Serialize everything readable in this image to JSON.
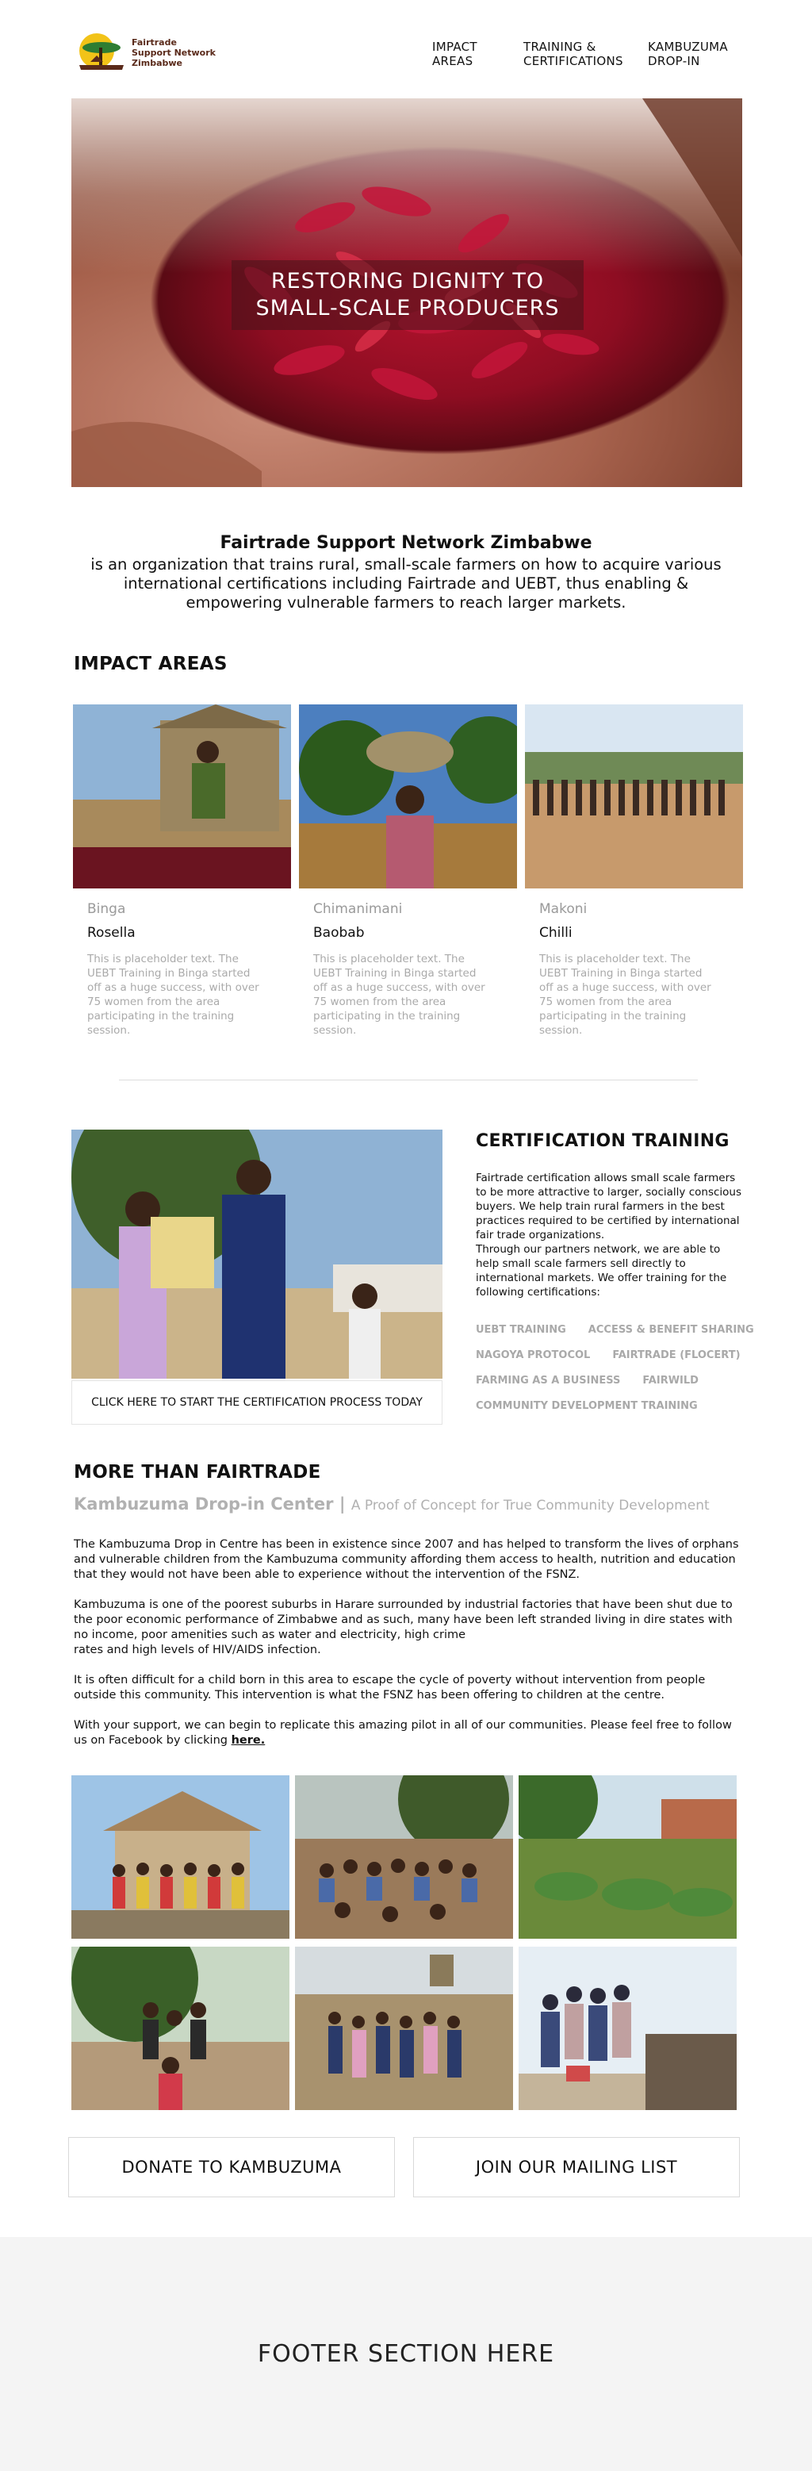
{
  "header": {
    "logo_text": [
      "Fairtrade",
      "Support Network",
      "Zimbabwe"
    ],
    "nav": [
      {
        "line1": "IMPACT",
        "line2": "AREAS"
      },
      {
        "line1": "TRAINING &",
        "line2": "CERTIFICATIONS"
      },
      {
        "line1": "KAMBUZUMA",
        "line2": "DROP-IN"
      }
    ]
  },
  "hero": {
    "title_line1": "RESTORING DIGNITY TO",
    "title_line2": "SMALL-SCALE PRODUCERS"
  },
  "intro": {
    "title": "Fairtrade Support Network Zimbabwe",
    "body": "is an organization that trains rural, small-scale farmers on how to acquire various international certifications including Fairtrade and UEBT, thus enabling & empowering vulnerable farmers to reach larger markets."
  },
  "impact": {
    "heading": "IMPACT AREAS",
    "cards": [
      {
        "location": "Binga",
        "crop": "Rosella",
        "desc": "This is placeholder text. The UEBT Training in Binga started off as a huge success, with over 75 women from the area participating in the training session."
      },
      {
        "location": "Chimanimani",
        "crop": "Baobab",
        "desc": "This is placeholder text. The UEBT Training in Binga started off as a huge success, with over 75 women from the area participating in the training session."
      },
      {
        "location": "Makoni",
        "crop": "Chilli",
        "desc": "This is placeholder text. The UEBT Training in Binga started off as a huge success, with over 75 women from the area participating in the training session."
      }
    ]
  },
  "certification": {
    "heading": "CERTIFICATION TRAINING",
    "cta": "CLICK HERE TO START THE CERTIFICATION PROCESS TODAY",
    "p1": "Fairtrade certification allows small scale farmers to be more attractive to larger, socially conscious buyers. We help train rural farmers in the best practices required to be certified by international fair trade organizations.",
    "p2": "Through our partners network, we are able to help small scale farmers sell directly to international markets. We offer training for the following certifications:",
    "tags": [
      "UEBT TRAINING",
      "ACCESS & BENEFIT SHARING",
      "NAGOYA PROTOCOL",
      "FAIRTRADE (FLOCERT)",
      "FARMING AS A  BUSINESS",
      "FAIRWILD",
      "COMMUNITY DEVELOPMENT TRAINING"
    ]
  },
  "more": {
    "heading": "MORE THAN FAIRTRADE",
    "sub_big": "Kambuzuma Drop-in Center | ",
    "sub_small": "A Proof of Concept for True Community Development",
    "p1": "The Kambuzuma Drop in Centre has been in existence since 2007 and has helped to transform the lives of orphans and vulnerable children from the Kambuzuma community affording them access to health, nutrition and education that they would not have been able to experience without the intervention of the FSNZ.",
    "p2a": "Kambuzuma is one of the poorest suburbs in Harare surrounded by industrial factories that have been shut due to the poor economic performance of Zimbabwe and as such, many have been left stranded living in dire states with no income, poor amenities such as water and electricity, high crime",
    "p2b": "rates and high levels of HIV/AIDS infection.",
    "p3": "It is often difficult for a child born in this area to escape the cycle of poverty without intervention from people outside this community. This intervention is what the FSNZ has been offering to children at the centre.",
    "p4": "With your support, we can begin to replicate this amazing pilot in all of our communities. Please feel free to follow us on Facebook by clicking ",
    "p4_link": "here."
  },
  "buttons": {
    "donate": "DONATE TO KAMBUZUMA",
    "mailing": "JOIN OUR MAILING LIST"
  },
  "footer": {
    "text": "FOOTER SECTION HERE"
  },
  "colors": {
    "muted_text": "#a9a9a9",
    "footer_bg": "#f4f4f4",
    "hero_red": "#b3132d"
  }
}
